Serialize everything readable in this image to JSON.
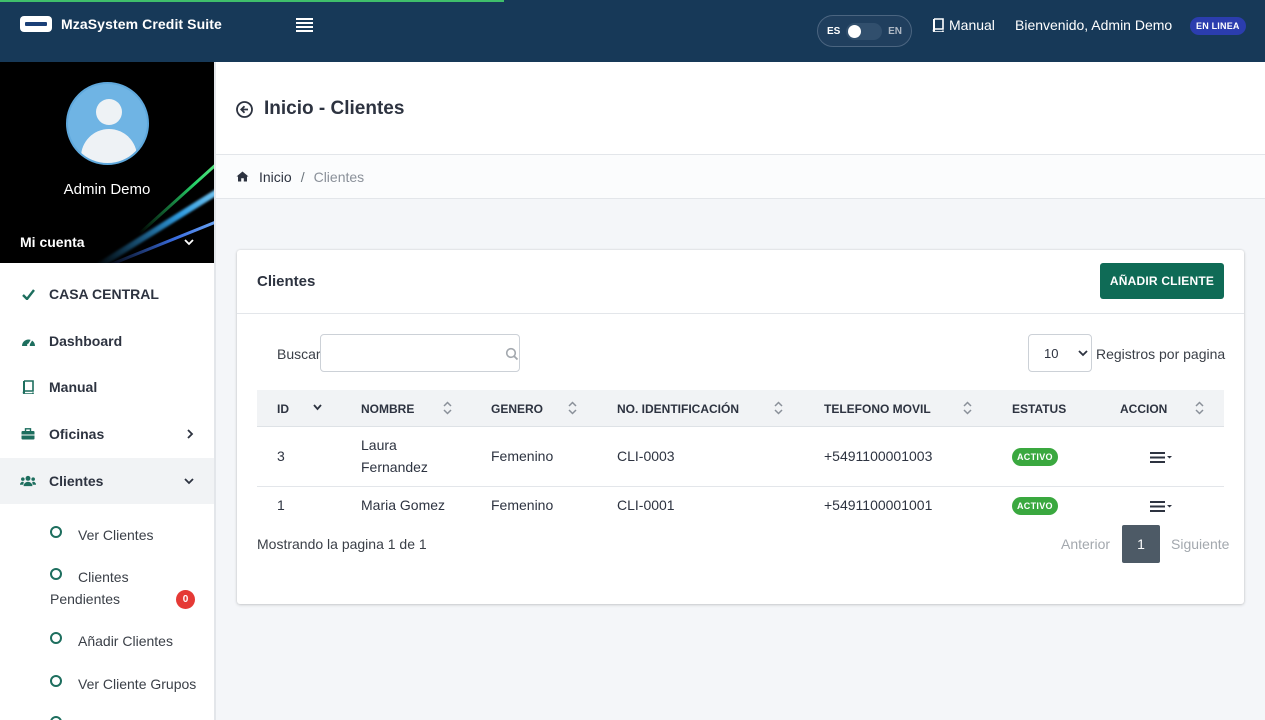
{
  "header": {
    "brand": "MzaSystem Credit Suite",
    "lang_es": "ES",
    "lang_en": "EN",
    "manual": "Manual",
    "welcome": "Bienvenido, Admin Demo",
    "status": "EN LINEA"
  },
  "sidebar": {
    "user_name": "Admin Demo",
    "account": "Mi cuenta",
    "items": [
      {
        "label": "CASA CENTRAL"
      },
      {
        "label": "Dashboard"
      },
      {
        "label": "Manual"
      },
      {
        "label": "Oficinas"
      },
      {
        "label": "Clientes"
      }
    ],
    "sub_items": [
      {
        "label": "Ver Clientes"
      },
      {
        "label": "Clientes Pendientes"
      },
      {
        "label": "Añadir Clientes"
      },
      {
        "label": "Ver Cliente Grupos"
      }
    ],
    "pending_count": "0"
  },
  "page": {
    "title": "Inicio - Clientes",
    "breadcrumb_home": "Inicio",
    "breadcrumb_sep": "/",
    "breadcrumb_current": "Clientes"
  },
  "card": {
    "title": "Clientes",
    "add_button": "AÑADIR CLIENTE",
    "search_label": "Buscar",
    "search_value": "",
    "page_size": "10",
    "page_size_label": "Registros por pagina",
    "footer": "Mostrando la pagina 1 de 1",
    "pager_prev": "Anterior",
    "pager_current": "1",
    "pager_next": "Siguiente"
  },
  "table": {
    "columns": [
      "ID",
      "NOMBRE",
      "GENERO",
      "NO. IDENTIFICACIÓN",
      "TELEFONO MOVIL",
      "ESTATUS",
      "ACCION"
    ],
    "rows": [
      {
        "id": "3",
        "nombre": "Laura Fernandez",
        "genero": "Femenino",
        "identificacion": "CLI-0003",
        "telefono": "+5491100001003",
        "estatus": "ACTIVO"
      },
      {
        "id": "1",
        "nombre": "Maria Gomez",
        "genero": "Femenino",
        "identificacion": "CLI-0001",
        "telefono": "+5491100001001",
        "estatus": "ACTIVO"
      }
    ]
  },
  "colors": {
    "navbar": "#173958",
    "primary_button": "#0f6b56",
    "status_active": "#3aa83f",
    "status_online": "#2b3dae",
    "badge_alert": "#e53935"
  },
  "icons": {
    "menu": "hamburger-icon",
    "manual": "book-icon",
    "back": "arrow-left-circle-icon",
    "home": "home-icon",
    "search": "search-icon",
    "check": "check-icon",
    "dashboard": "gauge-icon",
    "offices": "briefcase-icon",
    "clients": "users-icon",
    "sort": "sort-icon",
    "action": "action-menu-icon"
  }
}
